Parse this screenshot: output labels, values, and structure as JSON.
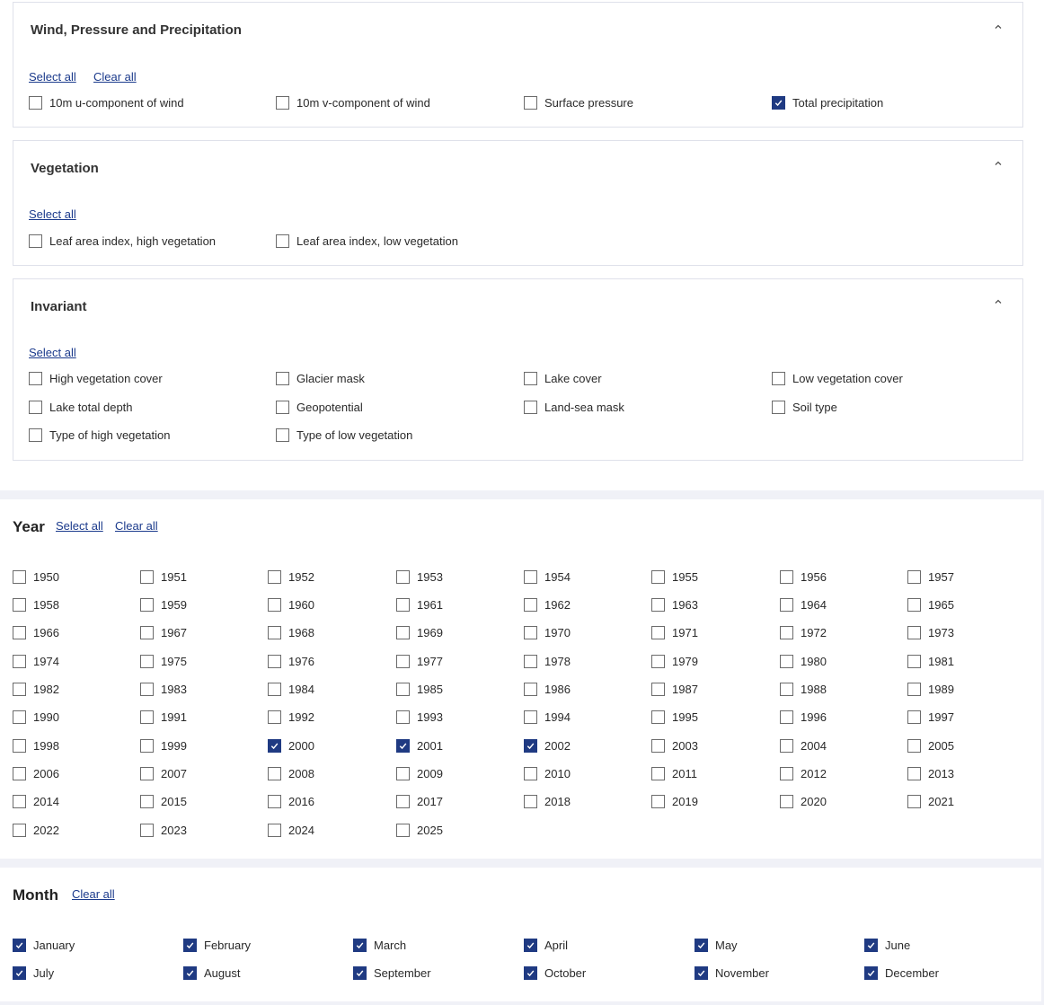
{
  "variables": {
    "wind": {
      "title": "Wind, Pressure and Precipitation",
      "select_all": "Select all",
      "clear_all": "Clear all",
      "items": [
        {
          "label": "10m u-component of wind",
          "checked": false
        },
        {
          "label": "10m v-component of wind",
          "checked": false
        },
        {
          "label": "Surface pressure",
          "checked": false
        },
        {
          "label": "Total precipitation",
          "checked": true
        }
      ]
    },
    "vegetation": {
      "title": "Vegetation",
      "select_all": "Select all",
      "items": [
        {
          "label": "Leaf area index, high vegetation",
          "checked": false
        },
        {
          "label": "Leaf area index, low vegetation",
          "checked": false
        }
      ]
    },
    "invariant": {
      "title": "Invariant",
      "select_all": "Select all",
      "items": [
        {
          "label": "High vegetation cover",
          "checked": false
        },
        {
          "label": "Glacier mask",
          "checked": false
        },
        {
          "label": "Lake cover",
          "checked": false
        },
        {
          "label": "Low vegetation cover",
          "checked": false
        },
        {
          "label": "Lake total depth",
          "checked": false
        },
        {
          "label": "Geopotential",
          "checked": false
        },
        {
          "label": "Land-sea mask",
          "checked": false
        },
        {
          "label": "Soil type",
          "checked": false
        },
        {
          "label": "Type of high vegetation",
          "checked": false
        },
        {
          "label": "Type of low vegetation",
          "checked": false
        }
      ]
    }
  },
  "year": {
    "title": "Year",
    "select_all": "Select all",
    "clear_all": "Clear all",
    "items": [
      {
        "label": "1950",
        "checked": false
      },
      {
        "label": "1951",
        "checked": false
      },
      {
        "label": "1952",
        "checked": false
      },
      {
        "label": "1953",
        "checked": false
      },
      {
        "label": "1954",
        "checked": false
      },
      {
        "label": "1955",
        "checked": false
      },
      {
        "label": "1956",
        "checked": false
      },
      {
        "label": "1957",
        "checked": false
      },
      {
        "label": "1958",
        "checked": false
      },
      {
        "label": "1959",
        "checked": false
      },
      {
        "label": "1960",
        "checked": false
      },
      {
        "label": "1961",
        "checked": false
      },
      {
        "label": "1962",
        "checked": false
      },
      {
        "label": "1963",
        "checked": false
      },
      {
        "label": "1964",
        "checked": false
      },
      {
        "label": "1965",
        "checked": false
      },
      {
        "label": "1966",
        "checked": false
      },
      {
        "label": "1967",
        "checked": false
      },
      {
        "label": "1968",
        "checked": false
      },
      {
        "label": "1969",
        "checked": false
      },
      {
        "label": "1970",
        "checked": false
      },
      {
        "label": "1971",
        "checked": false
      },
      {
        "label": "1972",
        "checked": false
      },
      {
        "label": "1973",
        "checked": false
      },
      {
        "label": "1974",
        "checked": false
      },
      {
        "label": "1975",
        "checked": false
      },
      {
        "label": "1976",
        "checked": false
      },
      {
        "label": "1977",
        "checked": false
      },
      {
        "label": "1978",
        "checked": false
      },
      {
        "label": "1979",
        "checked": false
      },
      {
        "label": "1980",
        "checked": false
      },
      {
        "label": "1981",
        "checked": false
      },
      {
        "label": "1982",
        "checked": false
      },
      {
        "label": "1983",
        "checked": false
      },
      {
        "label": "1984",
        "checked": false
      },
      {
        "label": "1985",
        "checked": false
      },
      {
        "label": "1986",
        "checked": false
      },
      {
        "label": "1987",
        "checked": false
      },
      {
        "label": "1988",
        "checked": false
      },
      {
        "label": "1989",
        "checked": false
      },
      {
        "label": "1990",
        "checked": false
      },
      {
        "label": "1991",
        "checked": false
      },
      {
        "label": "1992",
        "checked": false
      },
      {
        "label": "1993",
        "checked": false
      },
      {
        "label": "1994",
        "checked": false
      },
      {
        "label": "1995",
        "checked": false
      },
      {
        "label": "1996",
        "checked": false
      },
      {
        "label": "1997",
        "checked": false
      },
      {
        "label": "1998",
        "checked": false
      },
      {
        "label": "1999",
        "checked": false
      },
      {
        "label": "2000",
        "checked": true
      },
      {
        "label": "2001",
        "checked": true
      },
      {
        "label": "2002",
        "checked": true
      },
      {
        "label": "2003",
        "checked": false
      },
      {
        "label": "2004",
        "checked": false
      },
      {
        "label": "2005",
        "checked": false
      },
      {
        "label": "2006",
        "checked": false
      },
      {
        "label": "2007",
        "checked": false
      },
      {
        "label": "2008",
        "checked": false
      },
      {
        "label": "2009",
        "checked": false
      },
      {
        "label": "2010",
        "checked": false
      },
      {
        "label": "2011",
        "checked": false
      },
      {
        "label": "2012",
        "checked": false
      },
      {
        "label": "2013",
        "checked": false
      },
      {
        "label": "2014",
        "checked": false
      },
      {
        "label": "2015",
        "checked": false
      },
      {
        "label": "2016",
        "checked": false
      },
      {
        "label": "2017",
        "checked": false
      },
      {
        "label": "2018",
        "checked": false
      },
      {
        "label": "2019",
        "checked": false
      },
      {
        "label": "2020",
        "checked": false
      },
      {
        "label": "2021",
        "checked": false
      },
      {
        "label": "2022",
        "checked": false
      },
      {
        "label": "2023",
        "checked": false
      },
      {
        "label": "2024",
        "checked": false
      },
      {
        "label": "2025",
        "checked": false
      }
    ]
  },
  "month": {
    "title": "Month",
    "clear_all": "Clear all",
    "items": [
      {
        "label": "January",
        "checked": true
      },
      {
        "label": "February",
        "checked": true
      },
      {
        "label": "March",
        "checked": true
      },
      {
        "label": "April",
        "checked": true
      },
      {
        "label": "May",
        "checked": true
      },
      {
        "label": "June",
        "checked": true
      },
      {
        "label": "July",
        "checked": true
      },
      {
        "label": "August",
        "checked": true
      },
      {
        "label": "September",
        "checked": true
      },
      {
        "label": "October",
        "checked": true
      },
      {
        "label": "November",
        "checked": true
      },
      {
        "label": "December",
        "checked": true
      }
    ]
  },
  "colors": {
    "accent": "#1f3a82",
    "link": "#1b3a8c",
    "page_bg": "#f0f1f7"
  }
}
